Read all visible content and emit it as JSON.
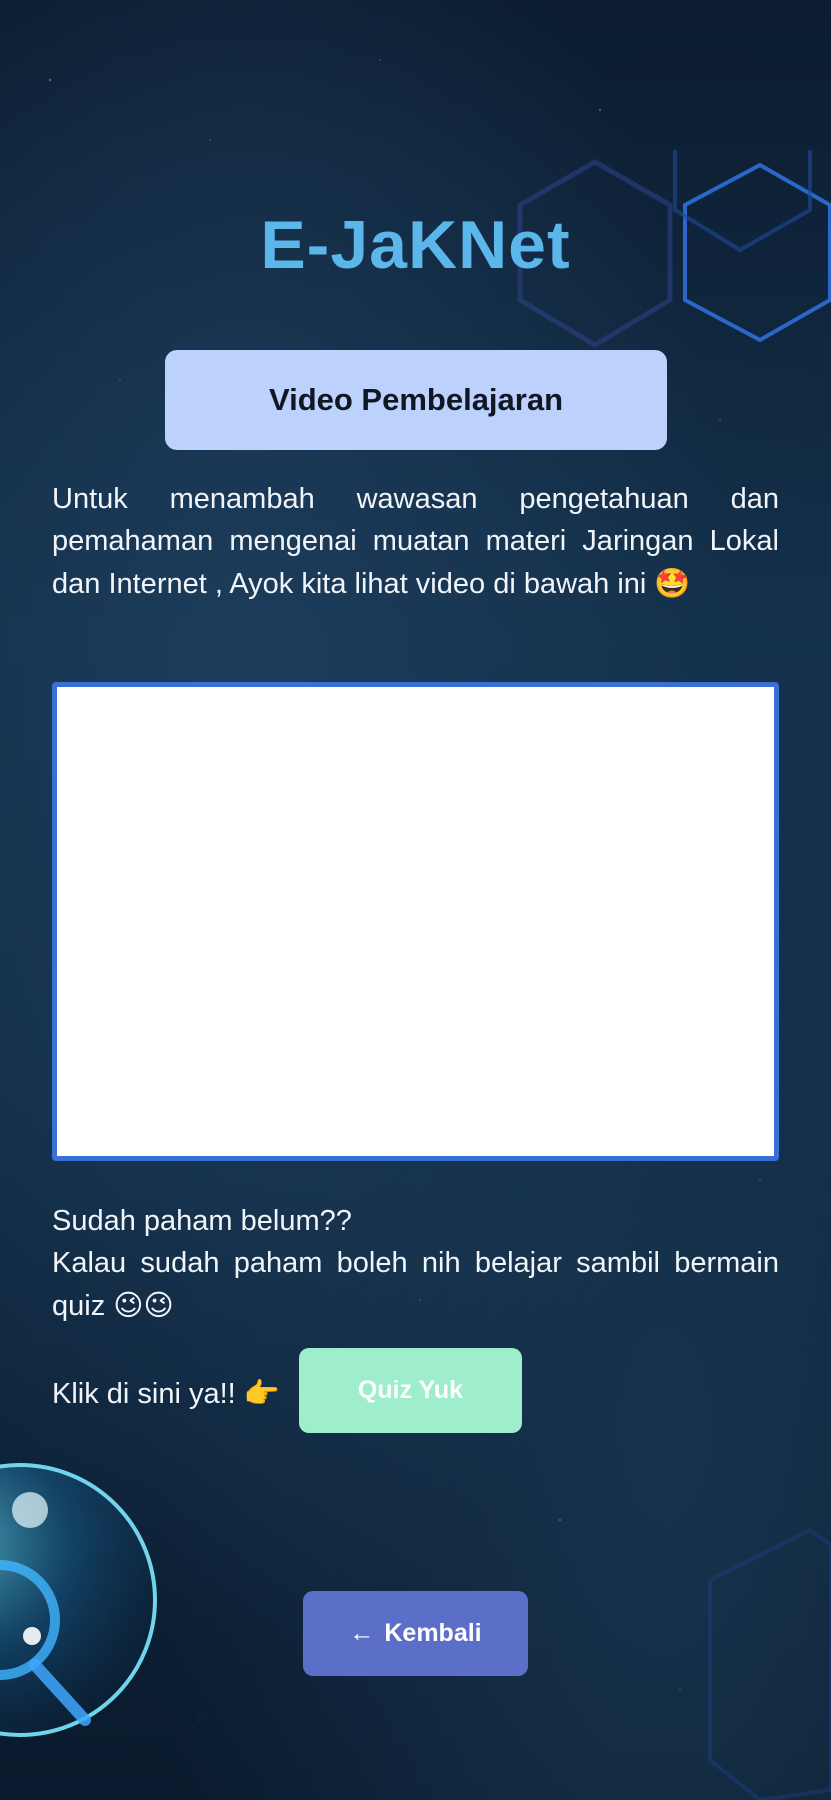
{
  "app": {
    "title": "E-JaKNet"
  },
  "section": {
    "header": "Video Pembelajaran",
    "intro": "Untuk menambah wawasan pengetahuan dan pemahaman mengenai muatan materi Jaringan Lokal dan Internet , Ayok kita lihat video di bawah ini",
    "intro_emoji": "🤩"
  },
  "prompt": {
    "line1": "Sudah paham belum??",
    "line2": "Kalau sudah paham boleh nih belajar sambil bermain quiz",
    "line2_emoji": "😉😉",
    "cta_label": "Klik di sini ya!!",
    "cta_emoji": "👉"
  },
  "buttons": {
    "quiz_label": "Quiz Yuk",
    "back_label": "Kembali",
    "back_icon": "←"
  },
  "colors": {
    "title": "#5bb6ea",
    "header_bg": "#bcd1fb",
    "quiz_bg": "#9feecb",
    "back_bg": "#5b6fc9",
    "video_border": "#3a6fd6"
  },
  "icons": {
    "back": "arrow-left-icon",
    "cta": "pointing-hand-icon"
  }
}
